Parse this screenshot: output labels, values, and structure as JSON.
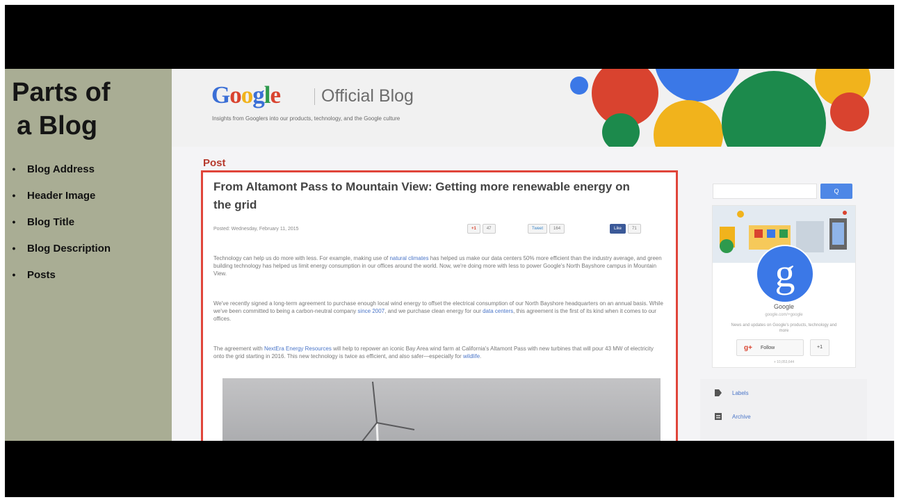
{
  "slide": {
    "title_line1": "Parts of",
    "title_line2": "a Blog",
    "bullets": [
      "Blog Address",
      "Header Image",
      "Blog Title",
      "Blog Description",
      "Posts"
    ]
  },
  "blog": {
    "logo": "Google",
    "name": "Official Blog",
    "description": "Insights from Googlers into our products, technology, and the Google culture",
    "post_label": "Post",
    "post": {
      "title": "From Altamont Pass to Mountain View: Getting more renewable energy on the grid",
      "meta": "Posted: Wednesday, February 11, 2015",
      "share": {
        "gplus": "+1",
        "gplus_count": "47",
        "tweet": "Tweet",
        "tweet_count": "164",
        "like": "Like",
        "like_count": "71"
      },
      "para1_a": "Technology can help us do more with less. For example, making use of ",
      "para1_link": "natural climates",
      "para1_b": " has helped us make our data centers 50% more efficient than the industry average, and green building technology has helped us limit energy consumption in our offices around the world. Now, we're doing more with less to power Google's North Bayshore campus in Mountain View.",
      "para2_a": "We've recently signed a long-term agreement to purchase enough local wind energy to offset the electrical consumption of our North Bayshore headquarters on an annual basis. While we've been committed to being a carbon-neutral company ",
      "para2_link1": "since 2007",
      "para2_b": ", and we purchase clean energy for our ",
      "para2_link2": "data centers",
      "para2_c": ", this agreement is the first of its kind when it comes to our offices.",
      "para3_a": "The agreement with ",
      "para3_link1": "NextEra Energy Resources",
      "para3_b": " will help to repower an iconic Bay Area wind farm at California's Altamont Pass with new turbines that will pour 43 MW of electricity onto the grid starting in 2016. This new technology is twice as efficient, and also safer—especially for ",
      "para3_link2": "wildlife",
      "para3_c": "."
    },
    "sidebar": {
      "search_button": "Q",
      "profile_name": "Google",
      "profile_handle": "google.com/+google",
      "profile_desc": "News and updates on Google's products, technology and more",
      "follow_label": "Follow",
      "plusone_label": "+1",
      "followers": "+ 10,053,644",
      "links": [
        "Labels",
        "Archive"
      ]
    }
  },
  "colors": {
    "red": "#d9432f",
    "blue": "#3b78e7",
    "yellow": "#f1b31c",
    "green": "#1c8a4c",
    "panel": "#a9ad94"
  }
}
